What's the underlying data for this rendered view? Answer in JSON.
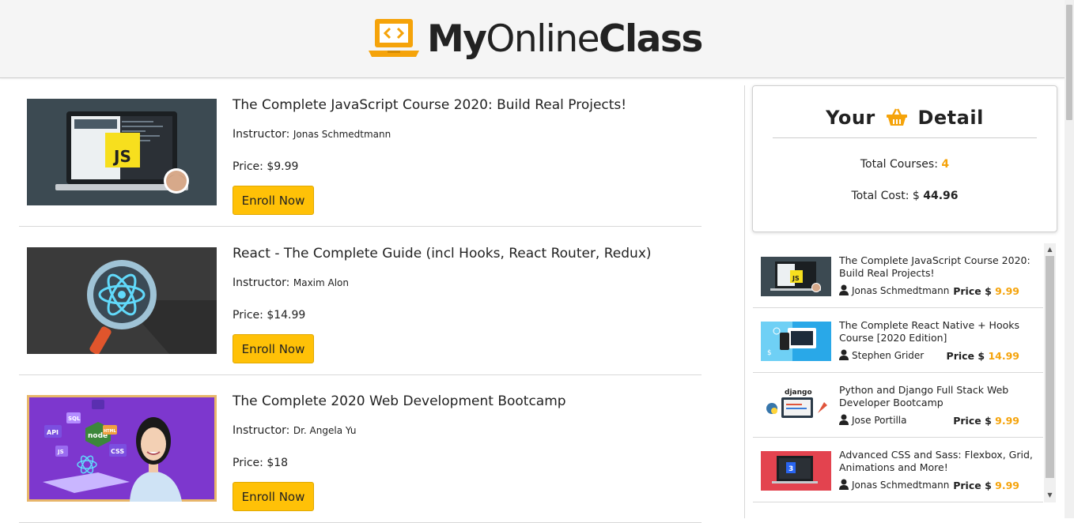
{
  "brand": {
    "name_bold_1": "My",
    "name_normal": "Online",
    "name_bold_2": "Class"
  },
  "courses": [
    {
      "title": "The Complete JavaScript Course 2020: Build Real Projects!",
      "instructor_label": "Instructor:",
      "instructor": "Jonas Schmedtmann",
      "price": "Price: $9.99",
      "button": "Enroll Now"
    },
    {
      "title": "React - The Complete Guide (incl Hooks, React Router, Redux)",
      "instructor_label": "Instructor:",
      "instructor": "Maxim Alon",
      "price": "Price: $14.99",
      "button": "Enroll Now"
    },
    {
      "title": "The Complete 2020 Web Development Bootcamp",
      "instructor_label": "Instructor:",
      "instructor": "Dr. Angela Yu",
      "price": "Price: $18",
      "button": "Enroll Now"
    }
  ],
  "detail": {
    "title_left": "Your",
    "title_right": "Detail",
    "title_icon": "basket-icon",
    "total_courses_label": "Total Courses:",
    "total_courses": "4",
    "total_cost_label": "Total Cost: $",
    "total_cost": "44.96"
  },
  "cart": [
    {
      "title": "The Complete JavaScript Course 2020: Build Real Projects!",
      "author": "Jonas Schmedtmann",
      "price_label": "Price $",
      "price": "9.99"
    },
    {
      "title": "The Complete React Native + Hooks Course [2020 Edition]",
      "author": "Stephen Grider",
      "price_label": "Price $",
      "price": "14.99"
    },
    {
      "title": "Python and Django Full Stack Web Developer Bootcamp",
      "author": "Jose Portilla",
      "price_label": "Price $",
      "price": "9.99"
    },
    {
      "title": "Advanced CSS and Sass: Flexbox, Grid, Animations and More!",
      "author": "Jonas Schmedtmann",
      "price_label": "Price $",
      "price": "9.99"
    }
  ],
  "thumb_labels": {
    "js": "JS",
    "sql": "SQL",
    "api": "API",
    "node": "node",
    "css": "CSS",
    "html": "HTML",
    "django": "django"
  },
  "colors": {
    "accent": "#ffc107",
    "price_orange": "#f5a30a",
    "header_bg": "#f5f5f5"
  }
}
